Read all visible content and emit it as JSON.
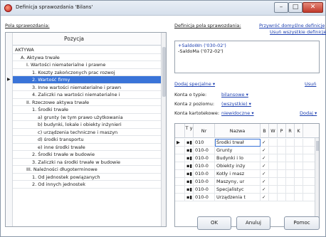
{
  "window": {
    "title": "Definicja sprawozdania 'Bilans'",
    "min_glyph": "–",
    "max_glyph": "□",
    "close_glyph": "✕"
  },
  "left": {
    "label": "Pola sprawozdania:",
    "column_header": "Pozycja",
    "rows": [
      {
        "text": "AKTYWA",
        "indent": 0
      },
      {
        "text": "A. Aktywa trwałe",
        "indent": 1
      },
      {
        "text": "I. Wartości niematerialne i prawne",
        "indent": 2
      },
      {
        "text": "1. Koszty zakończonych prac rozwoj",
        "indent": 3
      },
      {
        "text": "2. Wartość firmy",
        "indent": 3,
        "selected": true
      },
      {
        "text": "3. Inne wartości niematerialne i prawn",
        "indent": 3
      },
      {
        "text": "4. Zaliczki na wartości niematerialne i",
        "indent": 3
      },
      {
        "text": "II. Rzeczowe aktywa trwałe",
        "indent": 2
      },
      {
        "text": "1. Środki trwałe",
        "indent": 3
      },
      {
        "text": "a) grunty (w tym prawo użytkowania",
        "indent": 4
      },
      {
        "text": "b) budynki, lokale i obiekty inżynieri",
        "indent": 4
      },
      {
        "text": "c) urządzenia techniczne i maszyn",
        "indent": 4
      },
      {
        "text": "d) środki transportu",
        "indent": 4
      },
      {
        "text": "e) inne środki trwałe",
        "indent": 4
      },
      {
        "text": "2. Środki trwałe w budowie",
        "indent": 3
      },
      {
        "text": "3. Zaliczki na środki trwałe w budowie",
        "indent": 3
      },
      {
        "text": "III. Należności długoterminowe",
        "indent": 2
      },
      {
        "text": "1. Od jednostek powiązanych",
        "indent": 3
      },
      {
        "text": "2. Od innych jednostek",
        "indent": 3
      }
    ],
    "row_marker": "▶"
  },
  "right": {
    "def_label": "Definicja pola sprawozdania:",
    "restore_link": "Przywróć domyślne definicje",
    "clear_link": "Usuń wszystkie definicje",
    "definitions": [
      {
        "text": "+SaldoWn ('030-02')",
        "selected": true
      },
      {
        "text": "-SaldoMa ('072-02')",
        "selected": false
      }
    ],
    "add_special_link": "Dodaj specjalne ▾",
    "remove_link": "Usuń",
    "type_label": "Konta o typie:",
    "type_value": "bilansowe ▾",
    "level_label": "Konta z poziomu:",
    "level_value": "(wszystkie) ▾",
    "card_label": "Konta kartotekowe:",
    "card_value": "niewidoczne ▾",
    "add_link": "Dodaj ▾",
    "table": {
      "headers": [
        "T y",
        "Nr",
        "Nazwa",
        "B",
        "W",
        "P",
        "R",
        "K"
      ],
      "rows": [
        {
          "type": "▪▮",
          "nr": "010",
          "name": "Środki trwał",
          "b": "✓",
          "current": true
        },
        {
          "type": "▪▮",
          "nr": "010-0",
          "name": "Grunty",
          "b": "✓"
        },
        {
          "type": "▪▮",
          "nr": "010-0",
          "name": "Budynki i lo",
          "b": "✓"
        },
        {
          "type": "▪▮",
          "nr": "010-0",
          "name": "Obiekty inży",
          "b": "✓"
        },
        {
          "type": "▪▮",
          "nr": "010-0",
          "name": "Kotły i masz",
          "b": "✓"
        },
        {
          "type": "▪▮",
          "nr": "010-0",
          "name": "Maszyny, ur",
          "b": "✓"
        },
        {
          "type": "▪▮",
          "nr": "010-0",
          "name": "Specjalistyc",
          "b": "✓"
        },
        {
          "type": "▪▮",
          "nr": "010-0",
          "name": "Urządzenia t",
          "b": "✓"
        }
      ],
      "row_marker": "▶"
    }
  },
  "buttons": {
    "ok": "OK",
    "cancel": "Anuluj",
    "help": "Pomoc"
  }
}
